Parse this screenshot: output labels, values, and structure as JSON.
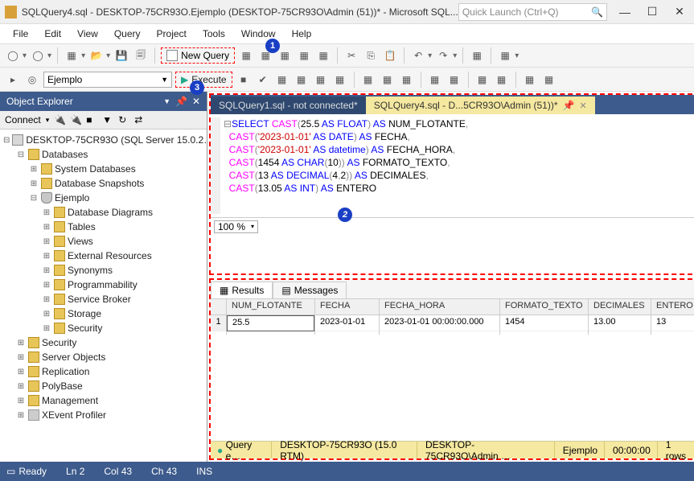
{
  "title": "SQLQuery4.sql - DESKTOP-75CR93O.Ejemplo (DESKTOP-75CR93O\\Admin (51))* - Microsoft SQL...",
  "quick_launch": "Quick Launch (Ctrl+Q)",
  "menu": {
    "file": "File",
    "edit": "Edit",
    "view": "View",
    "query": "Query",
    "project": "Project",
    "tools": "Tools",
    "window": "Window",
    "help": "Help"
  },
  "toolbar": {
    "new_query": "New Query"
  },
  "toolbar2": {
    "database": "Ejemplo",
    "execute": "Execute"
  },
  "callouts": {
    "one": "1",
    "two": "2",
    "three": "3"
  },
  "oe": {
    "title": "Object Explorer",
    "connect": "Connect",
    "server": "DESKTOP-75CR93O (SQL Server 15.0.2…",
    "databases": "Databases",
    "sysdb": "System Databases",
    "snap": "Database Snapshots",
    "ejemplo": "Ejemplo",
    "diag": "Database Diagrams",
    "tables": "Tables",
    "views": "Views",
    "extres": "External Resources",
    "syn": "Synonyms",
    "prog": "Programmability",
    "sb": "Service Broker",
    "storage": "Storage",
    "sec": "Security",
    "sec2": "Security",
    "srvobj": "Server Objects",
    "repl": "Replication",
    "poly": "PolyBase",
    "mgmt": "Management",
    "xev": "XEvent Profiler"
  },
  "tabs": {
    "t1": "SQLQuery1.sql - not connected*",
    "t2": "SQLQuery4.sql - D...5CR93O\\Admin (51))*"
  },
  "code": {
    "l1a": "SELECT",
    "l1b": "CAST",
    "l1c": "25.5",
    "l1d": "AS",
    "l1e": "FLOAT",
    "l1f": "AS",
    "l1g": "NUM_FLOTANTE",
    "l2a": "CAST",
    "l2b": "'2023-01-01'",
    "l2c": "AS",
    "l2d": "DATE",
    "l2e": "AS",
    "l2f": "FECHA",
    "l3a": "CAST",
    "l3b": "'2023-01-01'",
    "l3c": "AS",
    "l3d": "datetime",
    "l3e": "AS",
    "l3f": "FECHA_HORA",
    "l4a": "CAST",
    "l4b": "1454",
    "l4c": "AS",
    "l4d": "CHAR",
    "l4e": "10",
    "l4f": "AS",
    "l4g": "FORMATO_TEXTO",
    "l5a": "CAST",
    "l5b": "13",
    "l5c": "AS",
    "l5d": "DECIMAL",
    "l5e": "4",
    "l5f": "2",
    "l5g": "AS",
    "l5h": "DECIMALES",
    "l6a": "CAST",
    "l6b": "13.05",
    "l6c": "AS",
    "l6d": "INT",
    "l6e": "AS",
    "l6f": "ENTERO"
  },
  "zoom": "100 %",
  "results": {
    "tab_results": "Results",
    "tab_messages": "Messages",
    "h1": "NUM_FLOTANTE",
    "h2": "FECHA",
    "h3": "FECHA_HORA",
    "h4": "FORMATO_TEXTO",
    "h5": "DECIMALES",
    "h6": "ENTERO",
    "r1": "1",
    "v1": "25.5",
    "v2": "2023-01-01",
    "v3": "2023-01-01 00:00:00.000",
    "v4": "1454",
    "v5": "13.00",
    "v6": "13"
  },
  "status2": {
    "ok": "Query e…",
    "srv": "DESKTOP-75CR93O (15.0 RTM)",
    "usr": "DESKTOP-75CR93O\\Admin …",
    "db": "Ejemplo",
    "time": "00:00:00",
    "rows": "1 rows"
  },
  "status": {
    "ready": "Ready",
    "ln": "Ln 2",
    "col": "Col 43",
    "ch": "Ch 43",
    "ins": "INS"
  }
}
